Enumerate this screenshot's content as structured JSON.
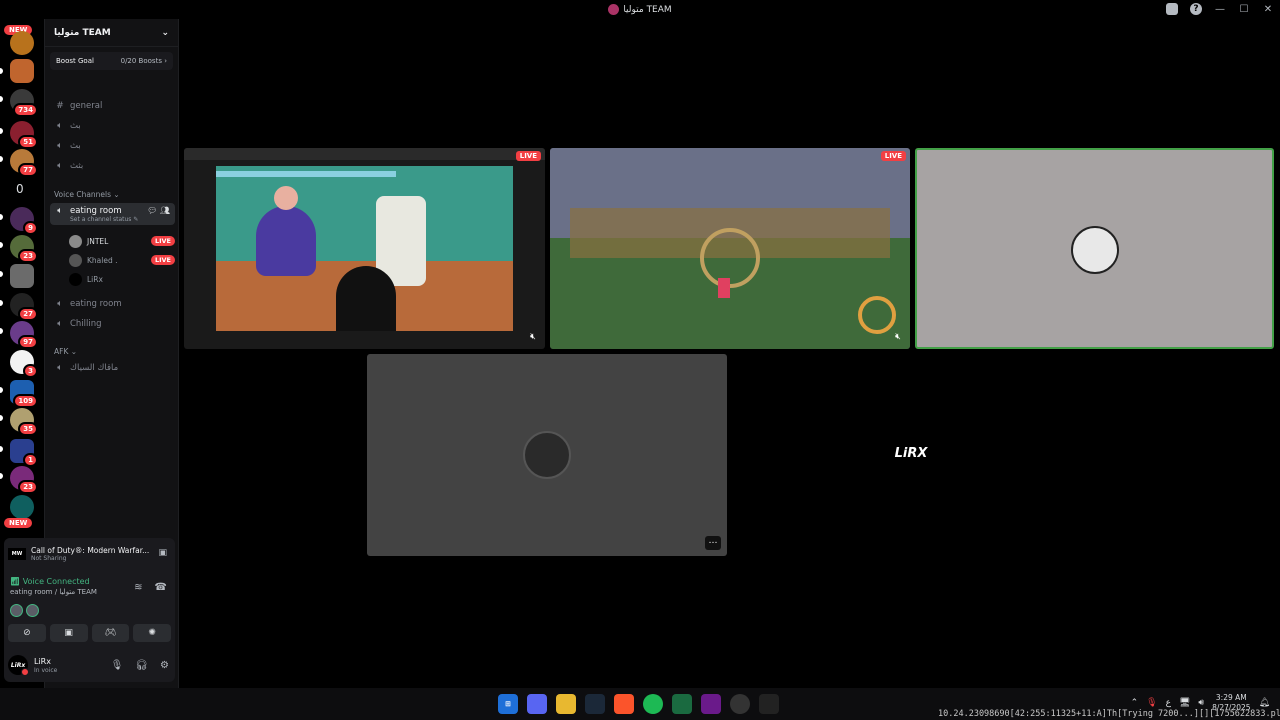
{
  "window": {
    "title": "متوليا TEAM",
    "controls": [
      "—",
      "☐",
      "✕"
    ]
  },
  "guilds": {
    "new_label": "NEW",
    "badges": [
      "734",
      "51",
      "77",
      "9",
      "23",
      "27",
      "97",
      "3",
      "109",
      "35",
      "1",
      "23"
    ],
    "zero": "0"
  },
  "server": {
    "name": "متوليا TEAM",
    "boost_label": "Boost Goal",
    "boost_count": "0/20 Boosts",
    "text_channels": [
      "general",
      "بث",
      "بث",
      "بثث"
    ],
    "voice_category": "Voice Channels",
    "active_channel": {
      "name": "eating room",
      "status": "Set a channel status"
    },
    "voice_users": [
      {
        "name": "JNTEL",
        "badge": "LIVE"
      },
      {
        "name": "Khaled .",
        "badge": "LIVE"
      },
      {
        "name": "LiRx",
        "badge": ""
      }
    ],
    "other_voice": [
      "eating room",
      "Chilling"
    ],
    "afk_category": "AFK",
    "afk_channel": "ماقاك السياك"
  },
  "panel": {
    "game_title": "Call of Duty®: Modern Warfar...",
    "game_status": "Not Sharing",
    "game_icon": "MW",
    "voice_status": "Voice Connected",
    "voice_location": "eating room / متوليا TEAM",
    "user_name": "LiRx",
    "user_status": "In voice",
    "user_avatar_text": "LiRx"
  },
  "stage": {
    "live_label": "LIVE",
    "tile5_logo": "LiRX"
  },
  "taskbar": {
    "time": "3:29 AM",
    "date": "8/27/2025",
    "overlay": "10.24.23098690[42:255:11325+11:A]Th[Trying 7200...][][1755622833.pl.G.steam]"
  },
  "colors": {
    "accent_live": "#f23f43",
    "voice_green": "#43b581",
    "bg": "#000000"
  }
}
